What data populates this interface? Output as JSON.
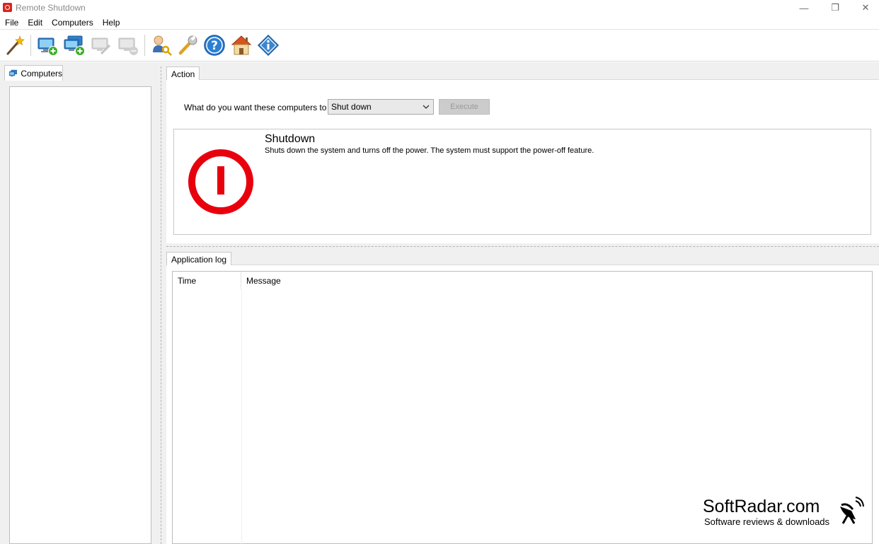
{
  "window": {
    "title": "Remote Shutdown",
    "controls": {
      "minimize": "—",
      "maximize": "❐",
      "close": "✕"
    }
  },
  "menu": [
    "File",
    "Edit",
    "Computers",
    "Help"
  ],
  "toolbar": [
    {
      "name": "wizard-icon",
      "enabled": true
    },
    {
      "name": "add-computer-icon",
      "enabled": true
    },
    {
      "name": "add-computers-icon",
      "enabled": true
    },
    {
      "name": "edit-computer-icon",
      "enabled": false
    },
    {
      "name": "remove-computer-icon",
      "enabled": false
    },
    {
      "name": "user-key-icon",
      "enabled": true
    },
    {
      "name": "wrench-icon",
      "enabled": true
    },
    {
      "name": "help-icon",
      "enabled": true
    },
    {
      "name": "home-icon",
      "enabled": true
    },
    {
      "name": "info-icon",
      "enabled": true
    }
  ],
  "left_panel": {
    "tab_label": "Computers"
  },
  "action": {
    "tab_label": "Action",
    "prompt": "What do you want these computers to do:",
    "selected": "Shut down",
    "execute_label": "Execute",
    "info_title": "Shutdown",
    "info_desc": "Shuts down the system and turns off the power. The system must support the power-off feature."
  },
  "log": {
    "tab_label": "Application log",
    "columns": [
      "Time",
      "Message"
    ]
  },
  "watermark": {
    "title": "SoftRadar.com",
    "subtitle": "Software reviews & downloads"
  },
  "colors": {
    "accent_red": "#e8000d",
    "panel_bg": "#f0f0f0",
    "border": "#c9c9c9"
  }
}
